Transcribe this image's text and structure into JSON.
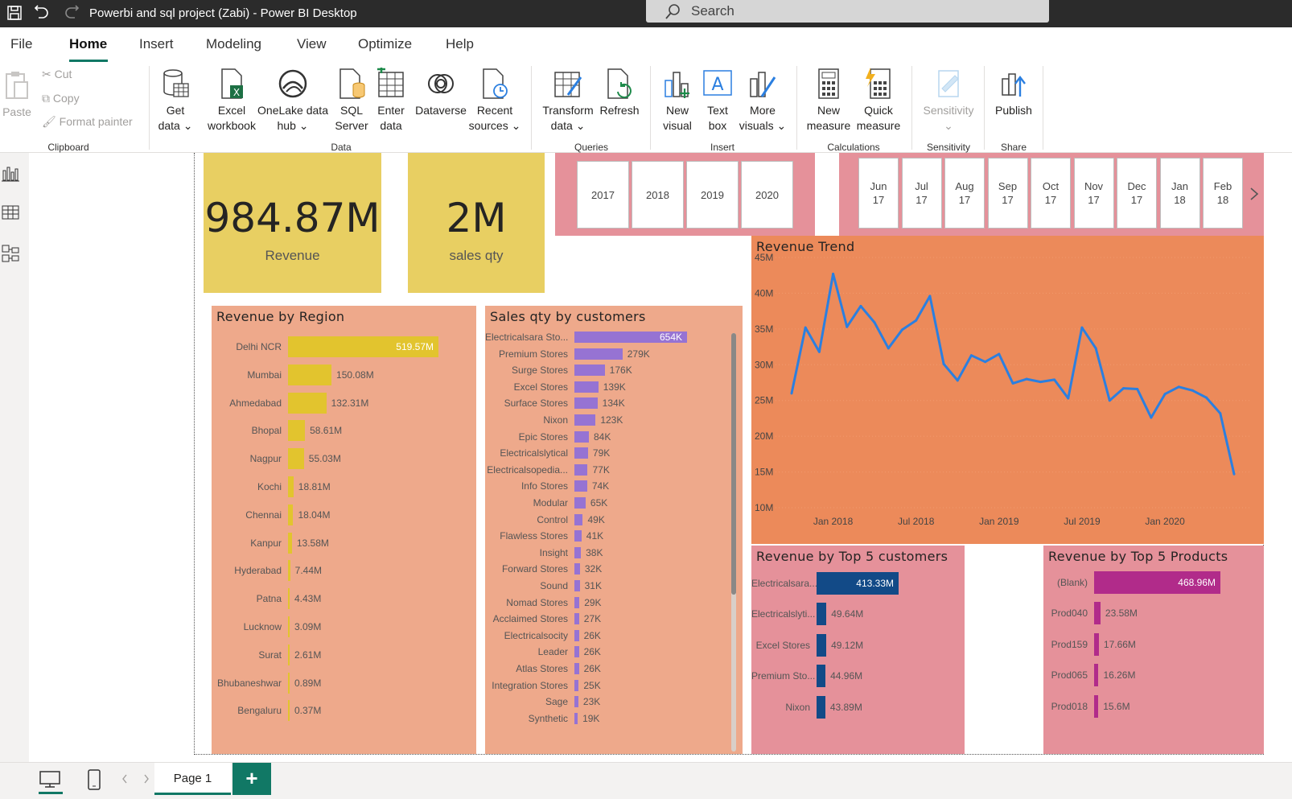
{
  "titlebar": {
    "title": "Powerbi and sql project (Zabi) - Power BI Desktop",
    "search_placeholder": "Search"
  },
  "menu": {
    "tabs": [
      "File",
      "Home",
      "Insert",
      "Modeling",
      "View",
      "Optimize",
      "Help"
    ],
    "active": "Home"
  },
  "ribbon": {
    "clipboard": {
      "paste": "Paste",
      "cut": "Cut",
      "copy": "Copy",
      "format_painter": "Format painter",
      "label": "Clipboard"
    },
    "data": {
      "get_data": [
        "Get",
        "data ⌄"
      ],
      "excel": [
        "Excel",
        "workbook"
      ],
      "onelake": [
        "OneLake data",
        "hub ⌄"
      ],
      "sql": [
        "SQL",
        "Server"
      ],
      "enter": [
        "Enter",
        "data"
      ],
      "dataverse": [
        "Dataverse",
        ""
      ],
      "recent": [
        "Recent",
        "sources ⌄"
      ],
      "label": "Data"
    },
    "queries": {
      "transform": [
        "Transform",
        "data ⌄"
      ],
      "refresh": [
        "Refresh",
        ""
      ],
      "label": "Queries"
    },
    "insert": {
      "new_visual": [
        "New",
        "visual"
      ],
      "text_box": [
        "Text",
        "box"
      ],
      "more_visuals": [
        "More",
        "visuals ⌄"
      ],
      "label": "Insert"
    },
    "calculations": {
      "new_measure": [
        "New",
        "measure"
      ],
      "quick_measure": [
        "Quick",
        "measure"
      ],
      "label": "Calculations"
    },
    "sensitivity": {
      "btn": [
        "Sensitivity",
        "⌄"
      ],
      "label": "Sensitivity"
    },
    "share": {
      "publish": "Publish",
      "label": "Share"
    }
  },
  "cards": [
    {
      "value": "984.87M",
      "label": "Revenue"
    },
    {
      "value": "2M",
      "label": "sales qty"
    }
  ],
  "year_slicer": [
    "2017",
    "2018",
    "2019",
    "2020"
  ],
  "month_slicer": [
    [
      "Jun",
      "17"
    ],
    [
      "Jul",
      "17"
    ],
    [
      "Aug",
      "17"
    ],
    [
      "Sep",
      "17"
    ],
    [
      "Oct",
      "17"
    ],
    [
      "Nov",
      "17"
    ],
    [
      "Dec",
      "17"
    ],
    [
      "Jan",
      "18"
    ],
    [
      "Feb",
      "18"
    ]
  ],
  "status": {
    "page_tab": "Page 1",
    "add": "+"
  },
  "colors": {
    "card": "#e8cf62",
    "region_bar": "#e2c42e",
    "customer_bar": "#9673d3",
    "trend_bg": "#ec8a5a",
    "trend_line": "#2b7fe0",
    "top_cust_bar": "#124a87",
    "top_prod_bar": "#b12b8a"
  },
  "chart_data": [
    {
      "type": "bar",
      "title": "Revenue by Region",
      "categories": [
        "Delhi NCR",
        "Mumbai",
        "Ahmedabad",
        "Bhopal",
        "Nagpur",
        "Kochi",
        "Chennai",
        "Kanpur",
        "Hyderabad",
        "Patna",
        "Lucknow",
        "Surat",
        "Bhubaneshwar",
        "Bengaluru"
      ],
      "values": [
        519.57,
        150.08,
        132.31,
        58.61,
        55.03,
        18.81,
        18.04,
        13.58,
        7.44,
        4.43,
        3.09,
        2.61,
        0.89,
        0.37
      ],
      "labels": [
        "519.57M",
        "150.08M",
        "132.31M",
        "58.61M",
        "55.03M",
        "18.81M",
        "18.04M",
        "13.58M",
        "7.44M",
        "4.43M",
        "3.09M",
        "2.61M",
        "0.89M",
        "0.37M"
      ]
    },
    {
      "type": "bar",
      "title": "Sales qty by customers",
      "categories": [
        "Electricalsara Sto...",
        "Premium Stores",
        "Surge Stores",
        "Excel Stores",
        "Surface Stores",
        "Nixon",
        "Epic Stores",
        "Electricalslytical",
        "Electricalsopedia...",
        "Info Stores",
        "Modular",
        "Control",
        "Flawless Stores",
        "Insight",
        "Forward Stores",
        "Sound",
        "Nomad Stores",
        "Acclaimed Stores",
        "Electricalsocity",
        "Leader",
        "Atlas Stores",
        "Integration Stores",
        "Sage",
        "Synthetic"
      ],
      "values": [
        654,
        279,
        176,
        139,
        134,
        123,
        84,
        79,
        77,
        74,
        65,
        49,
        41,
        38,
        32,
        31,
        29,
        27,
        26,
        26,
        26,
        25,
        23,
        19
      ],
      "labels": [
        "654K",
        "279K",
        "176K",
        "139K",
        "134K",
        "123K",
        "84K",
        "79K",
        "77K",
        "74K",
        "65K",
        "49K",
        "41K",
        "38K",
        "32K",
        "31K",
        "29K",
        "27K",
        "26K",
        "26K",
        "26K",
        "25K",
        "23K",
        "19K"
      ]
    },
    {
      "type": "line",
      "title": "Revenue Trend",
      "x_ticks": [
        "Jan 2018",
        "Jul 2018",
        "Jan 2019",
        "Jul 2019",
        "Jan 2020"
      ],
      "y_ticks": [
        "45M",
        "40M",
        "35M",
        "30M",
        "25M",
        "20M",
        "15M",
        "10M"
      ],
      "ylim": [
        10,
        45
      ],
      "x": [
        "2017-10",
        "2017-11",
        "2017-12",
        "2018-01",
        "2018-02",
        "2018-03",
        "2018-04",
        "2018-05",
        "2018-06",
        "2018-07",
        "2018-08",
        "2018-09",
        "2018-10",
        "2018-11",
        "2018-12",
        "2019-01",
        "2019-02",
        "2019-03",
        "2019-04",
        "2019-05",
        "2019-06",
        "2019-07",
        "2019-08",
        "2019-09",
        "2019-10",
        "2019-11",
        "2019-12",
        "2020-01",
        "2020-02",
        "2020-03",
        "2020-04",
        "2020-05",
        "2020-06"
      ],
      "values": [
        26.0,
        35.2,
        31.8,
        42.7,
        35.3,
        38.2,
        35.9,
        32.3,
        34.9,
        36.2,
        39.6,
        30.1,
        27.8,
        31.3,
        30.4,
        31.5,
        27.4,
        28.0,
        27.6,
        27.9,
        25.3,
        35.2,
        32.3,
        25.0,
        26.7,
        26.6,
        22.6,
        25.9,
        26.9,
        26.4,
        25.4,
        23.2,
        14.7
      ]
    },
    {
      "type": "bar",
      "title": "Revenue by Top 5 customers",
      "categories": [
        "Electricalsara...",
        "Electricalslyti...",
        "Excel Stores",
        "Premium Sto...",
        "Nixon"
      ],
      "values": [
        413.33,
        49.64,
        49.12,
        44.96,
        43.89
      ],
      "labels": [
        "413.33M",
        "49.64M",
        "49.12M",
        "44.96M",
        "43.89M"
      ]
    },
    {
      "type": "bar",
      "title": "Revenue by Top 5 Products",
      "categories": [
        "(Blank)",
        "Prod040",
        "Prod159",
        "Prod065",
        "Prod018"
      ],
      "values": [
        468.96,
        23.58,
        17.66,
        16.26,
        15.6
      ],
      "labels": [
        "468.96M",
        "23.58M",
        "17.66M",
        "16.26M",
        "15.6M"
      ]
    }
  ]
}
